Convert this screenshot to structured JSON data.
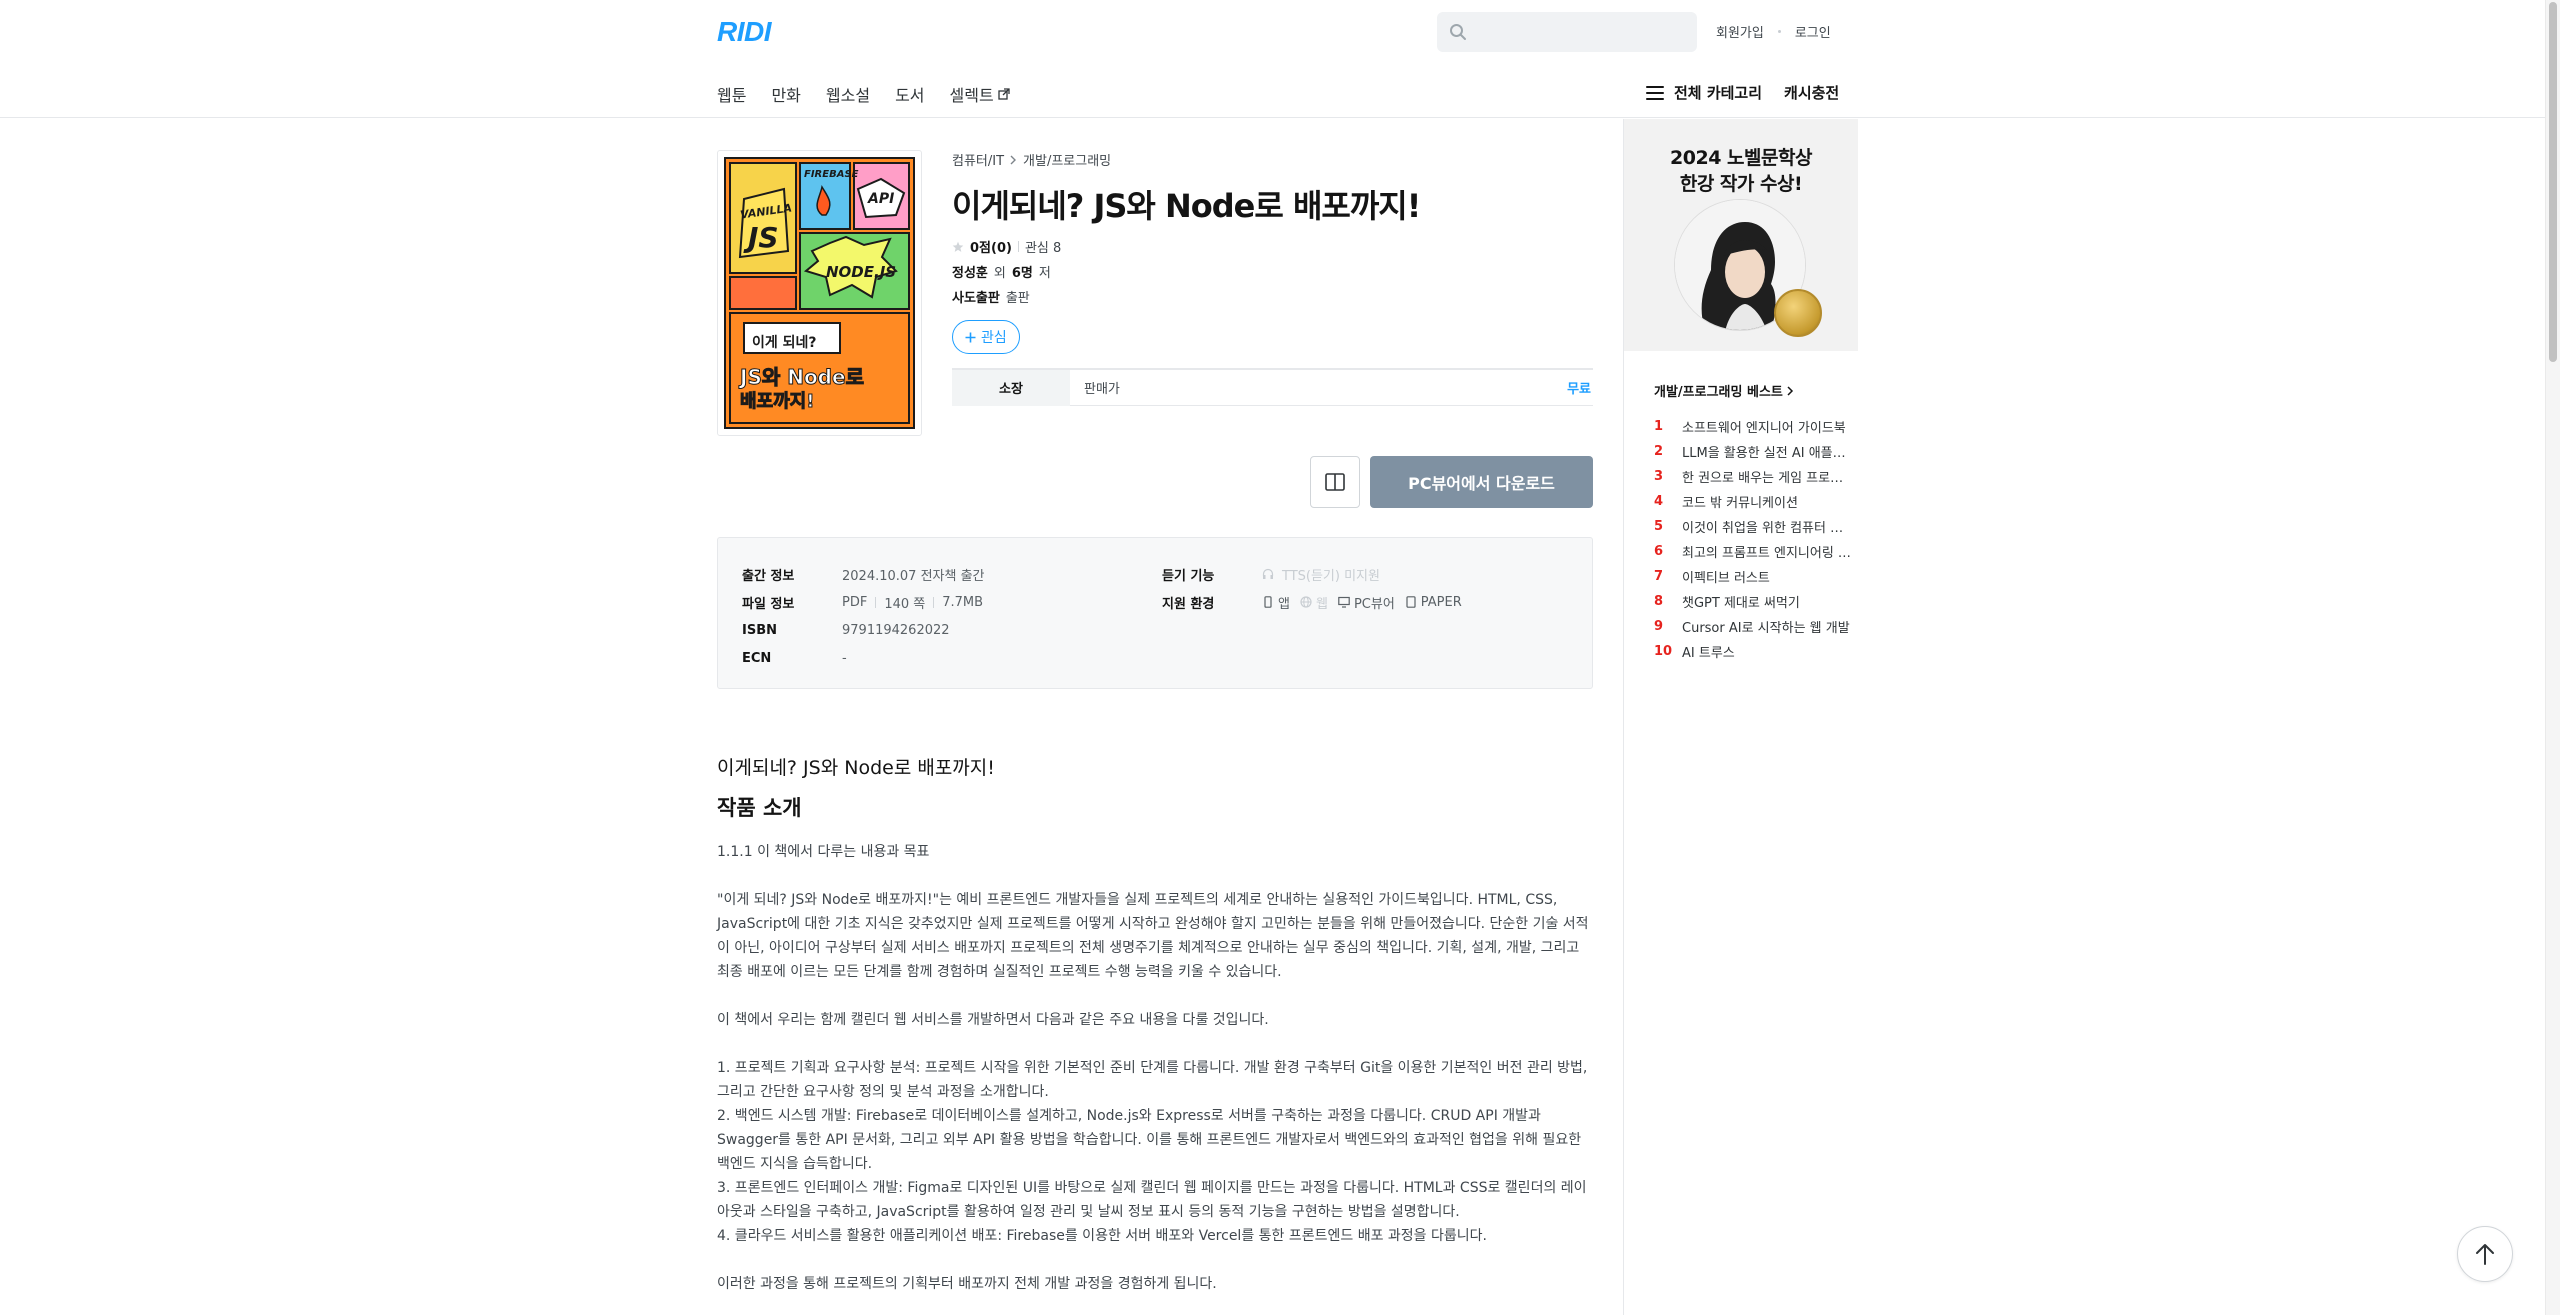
{
  "header": {
    "logo": "RIDI",
    "search_placeholder": "",
    "signup": "회원가입",
    "login": "로그인",
    "nav": [
      {
        "label": "웹툰"
      },
      {
        "label": "만화"
      },
      {
        "label": "웹소설"
      },
      {
        "label": "도서"
      },
      {
        "label": "셀렉트"
      }
    ],
    "all_categories": "전체 카테고리",
    "cash": "캐시충전"
  },
  "book": {
    "breadcrumb": [
      "컴퓨터/IT",
      "개발/프로그래밍"
    ],
    "title": "이게되네? JS와 Node로 배포까지!",
    "rating": "0점(0)",
    "interest": "관심 8",
    "author_name": "정성훈",
    "author_mid": "외",
    "author_count": "6명",
    "author_suffix": "저",
    "publisher": "사도출판",
    "publisher_suffix": "출판",
    "wish_label": "관심",
    "price_tab": "소장",
    "price_label": "판매가",
    "price_value": "무료",
    "download_label": "PC뷰어에서 다운로드",
    "cover": {
      "vanilla": "VANILLA",
      "js": "JS",
      "firebase": "FIREBASE",
      "api": "API",
      "node": "NODE.JS",
      "line1": "이게 되네?",
      "line2": "JS와 Node로",
      "line3": "배포까지!"
    }
  },
  "details": {
    "release_key": "출간 정보",
    "release_val": "2024.10.07 전자책 출간",
    "file_key": "파일 정보",
    "file_format": "PDF",
    "file_pages": "140 쪽",
    "file_size": "7.7MB",
    "isbn_key": "ISBN",
    "isbn_val": "9791194262022",
    "ecn_key": "ECN",
    "ecn_val": "-",
    "listen_key": "듣기 기능",
    "listen_val": "TTS(듣기) 미지원",
    "env_key": "지원 환경",
    "env_app": "앱",
    "env_web": "웹",
    "env_pc": "PC뷰어",
    "env_paper": "PAPER"
  },
  "intro": {
    "subtitle": "이게되네? JS와 Node로 배포까지!",
    "heading": "작품 소개",
    "body": "1.1.1 이 책에서 다루는 내용과 목표\n\n\"이게 되네? JS와 Node로 배포까지!\"는 예비 프론트엔드 개발자들을 실제 프로젝트의 세계로 안내하는 실용적인 가이드북입니다. HTML, CSS, JavaScript에 대한 기초 지식은 갖추었지만 실제 프로젝트를 어떻게 시작하고 완성해야 할지 고민하는 분들을 위해 만들어졌습니다. 단순한 기술 서적이 아닌, 아이디어 구상부터 실제 서비스 배포까지 프로젝트의 전체 생명주기를 체계적으로 안내하는 실무 중심의 책입니다. 기획, 설계, 개발, 그리고 최종 배포에 이르는 모든 단계를 함께 경험하며 실질적인 프로젝트 수행 능력을 키울 수 있습니다.\n\n이 책에서 우리는 함께 캘린더 웹 서비스를 개발하면서 다음과 같은 주요 내용을 다룰 것입니다.\n\n1. 프로젝트 기획과 요구사항 분석: 프로젝트 시작을 위한 기본적인 준비 단계를 다룹니다. 개발 환경 구축부터 Git을 이용한 기본적인 버전 관리 방법, 그리고 간단한 요구사항 정의 및 분석 과정을 소개합니다.\n2. 백엔드 시스템 개발: Firebase로 데이터베이스를 설계하고, Node.js와 Express로 서버를 구축하는 과정을 다룹니다. CRUD API 개발과 Swagger를 통한 API 문서화, 그리고 외부 API 활용 방법을 학습합니다. 이를 통해 프론트엔드 개발자로서 백엔드와의 효과적인 협업을 위해 필요한 백엔드 지식을 습득합니다.\n3. 프론트엔드 인터페이스 개발: Figma로 디자인된 UI를 바탕으로 실제 캘린더 웹 페이지를 만드는 과정을 다룹니다. HTML과 CSS로 캘린더의 레이아웃과 스타일을 구축하고, JavaScript를 활용하여 일정 관리 및 날씨 정보 표시 등의 동적 기능을 구현하는 방법을 설명합니다.\n4. 클라우드 서비스를 활용한 애플리케이션 배포: Firebase를 이용한 서버 배포와 Vercel를 통한 프론트엔드 배포 과정을 다룹니다.\n\n이러한 과정을 통해 프로젝트의 기획부터 배포까지 전체 개발 과정을 경험하게 됩니다."
  },
  "sidebar": {
    "banner_line1": "2024 노벨문학상",
    "banner_line2": "한강 작가 수상!",
    "best_title": "개발/프로그래밍 베스트",
    "best": [
      {
        "rank": "1",
        "name": "소프트웨어 엔지니어 가이드북"
      },
      {
        "rank": "2",
        "name": "LLM을 활용한 실전 AI 애플리케이션 개발"
      },
      {
        "rank": "3",
        "name": "한 권으로 배우는 게임 프로그래밍"
      },
      {
        "rank": "4",
        "name": "코드 밖 커뮤니케이션"
      },
      {
        "rank": "5",
        "name": "이것이 취업을 위한 컴퓨터 과학이다"
      },
      {
        "rank": "6",
        "name": "최고의 프롬프트 엔지니어링 강의"
      },
      {
        "rank": "7",
        "name": "이펙티브 러스트"
      },
      {
        "rank": "8",
        "name": "챗GPT 제대로 써먹기"
      },
      {
        "rank": "9",
        "name": "Cursor AI로 시작하는 웹 개발"
      },
      {
        "rank": "10",
        "name": "AI 트루스"
      }
    ]
  },
  "colors": {
    "brand": "#1e9eff",
    "rank": "#e6231e",
    "download_bg": "#7f91a2"
  }
}
